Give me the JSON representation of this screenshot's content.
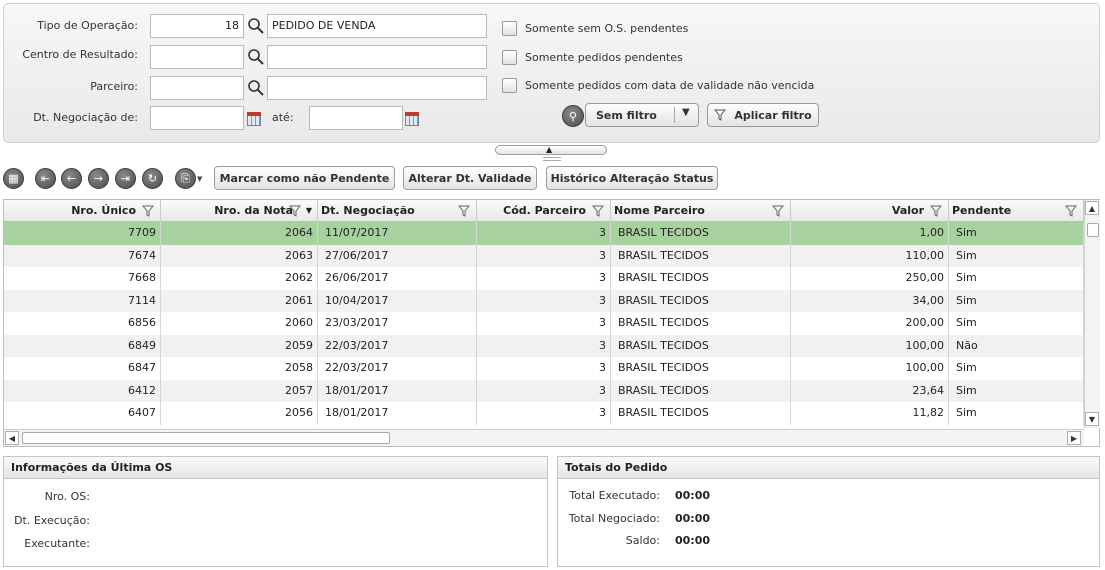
{
  "filters": {
    "tipo_operacao_label": "Tipo de Operação:",
    "tipo_operacao_code": "18",
    "tipo_operacao_desc": "PEDIDO DE VENDA",
    "centro_resultado_label": "Centro de Resultado:",
    "centro_resultado_code": "",
    "centro_resultado_desc": "",
    "parceiro_label": "Parceiro:",
    "parceiro_code": "",
    "parceiro_desc": "",
    "dt_negociacao_label": "Dt. Negociação de:",
    "dt_negociacao_from": "",
    "ate_label": "até:",
    "dt_negociacao_to": "",
    "chk_sem_os_label": "Somente sem O.S. pendentes",
    "chk_pedidos_pendentes_label": "Somente pedidos pendentes",
    "chk_validade_label": "Somente pedidos com data de validade não vencida",
    "sem_filtro_label": "Sem filtro",
    "aplicar_filtro_label": "Aplicar filtro"
  },
  "toolbar": {
    "marcar_label": "Marcar como não Pendente",
    "alterar_label": "Alterar Dt. Validade",
    "historico_label": "Histórico Alteração Status"
  },
  "grid": {
    "columns": [
      "Nro. Único",
      "Nro. da Nota",
      "Dt. Negociação",
      "Cód. Parceiro",
      "Nome Parceiro",
      "Valor",
      "Pendente"
    ],
    "rows": [
      [
        "7709",
        "2064",
        "11/07/2017",
        "3",
        "BRASIL TECIDOS",
        "1,00",
        "Sim"
      ],
      [
        "7674",
        "2063",
        "27/06/2017",
        "3",
        "BRASIL TECIDOS",
        "110,00",
        "Sim"
      ],
      [
        "7668",
        "2062",
        "26/06/2017",
        "3",
        "BRASIL TECIDOS",
        "250,00",
        "Sim"
      ],
      [
        "7114",
        "2061",
        "10/04/2017",
        "3",
        "BRASIL TECIDOS",
        "34,00",
        "Sim"
      ],
      [
        "6856",
        "2060",
        "23/03/2017",
        "3",
        "BRASIL TECIDOS",
        "200,00",
        "Sim"
      ],
      [
        "6849",
        "2059",
        "22/03/2017",
        "3",
        "BRASIL TECIDOS",
        "100,00",
        "Não"
      ],
      [
        "6847",
        "2058",
        "22/03/2017",
        "3",
        "BRASIL TECIDOS",
        "100,00",
        "Sim"
      ],
      [
        "6412",
        "2057",
        "18/01/2017",
        "3",
        "BRASIL TECIDOS",
        "23,64",
        "Sim"
      ],
      [
        "6407",
        "2056",
        "18/01/2017",
        "3",
        "BRASIL TECIDOS",
        "11,82",
        "Sim"
      ]
    ]
  },
  "ultima_os": {
    "title": "Informações da Última OS",
    "nro_os_label": "Nro. OS:",
    "dt_execucao_label": "Dt. Execução:",
    "executante_label": "Executante:"
  },
  "totais": {
    "title": "Totais do Pedido",
    "executado_label": "Total Executado:",
    "executado_value": "00:00",
    "negociado_label": "Total Negociado:",
    "negociado_value": "00:00",
    "saldo_label": "Saldo:",
    "saldo_value": "00:00"
  },
  "colors": {
    "selected_row": "#a8d1a0",
    "alt_row": "#f1f1f1"
  }
}
